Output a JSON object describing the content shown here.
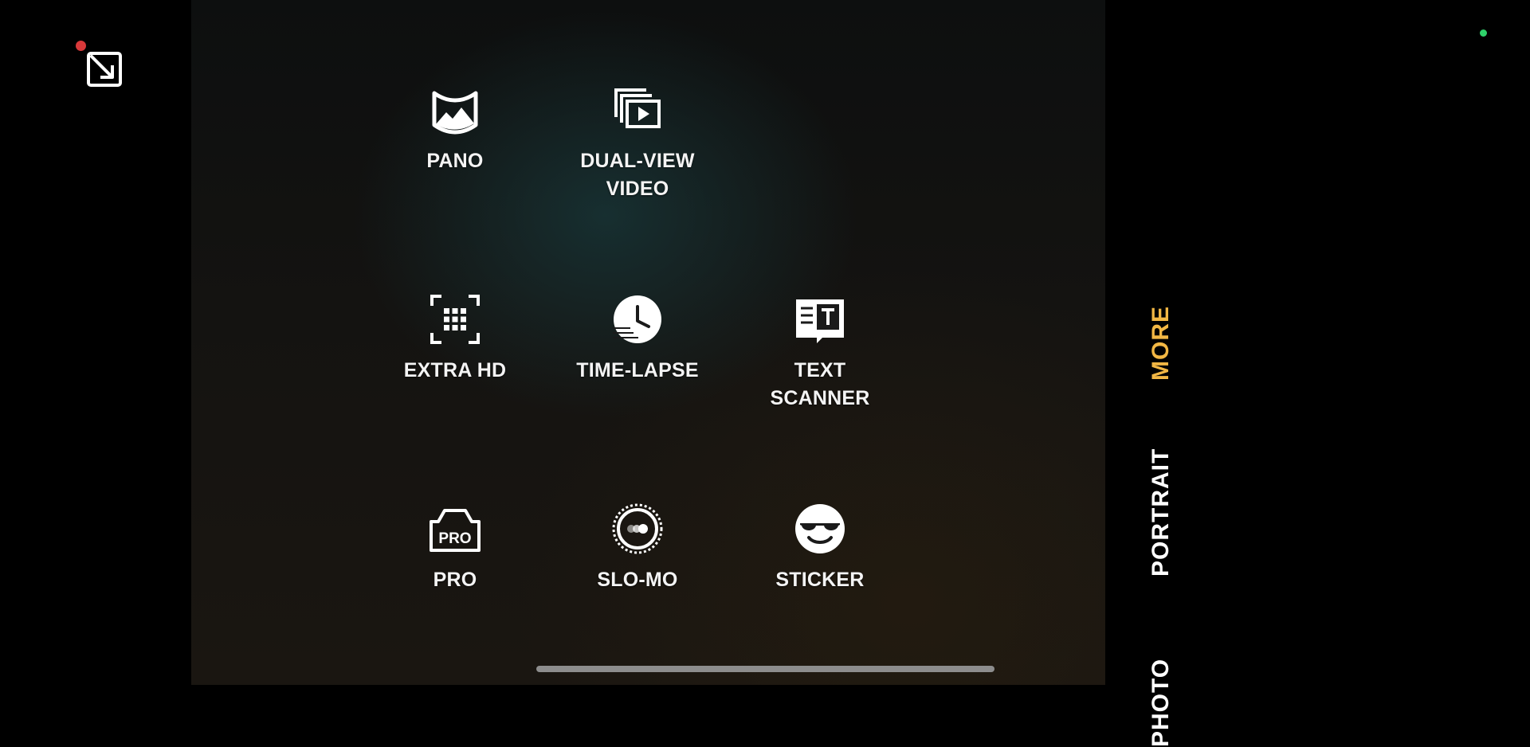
{
  "modes": [
    {
      "id": "pano",
      "label": "PANO",
      "icon": "panorama-icon"
    },
    {
      "id": "dual-view-video",
      "label": "DUAL-VIEW\nVIDEO",
      "icon": "dual-view-icon"
    },
    {
      "id": "extra-hd",
      "label": "EXTRA HD",
      "icon": "extra-hd-icon"
    },
    {
      "id": "time-lapse",
      "label": "TIME-LAPSE",
      "icon": "clock-icon"
    },
    {
      "id": "text-scanner",
      "label": "TEXT\nSCANNER",
      "icon": "text-scanner-icon"
    },
    {
      "id": "pro",
      "label": "PRO",
      "icon": "pro-camera-icon",
      "icon_text": "PRO"
    },
    {
      "id": "slo-mo",
      "label": "SLO-MO",
      "icon": "slow-motion-icon"
    },
    {
      "id": "sticker",
      "label": "STICKER",
      "icon": "sunglasses-face-icon"
    }
  ],
  "mode_tabs": [
    {
      "label": "MORE",
      "active": true
    },
    {
      "label": "PORTRAIT",
      "active": false
    },
    {
      "label": "PHOTO",
      "active": false
    }
  ],
  "colors": {
    "active_tab": "#f2b744",
    "recording_dot": "#d8393a",
    "status_dot": "#2fd16a"
  }
}
